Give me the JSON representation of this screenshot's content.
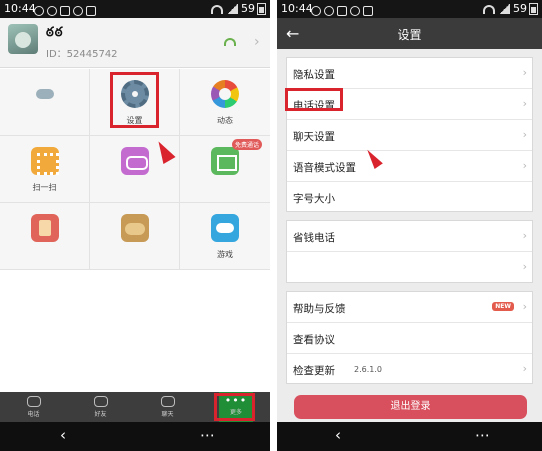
{
  "left": {
    "status": {
      "time": "10:44",
      "battery": "59"
    },
    "profile": {
      "name": "ఠఠ",
      "id": "ID：52445742"
    },
    "grid": [
      {
        "label": "",
        "icon": "cloud-icon"
      },
      {
        "label": "设置",
        "icon": "gear-icon"
      },
      {
        "label": "动态",
        "icon": "colorwheel-icon"
      },
      {
        "label": "扫一扫",
        "icon": "qr-scan-icon"
      },
      {
        "label": "",
        "icon": "purple-app-icon"
      },
      {
        "label": "",
        "icon": "mail-icon",
        "badge": "免费通话"
      },
      {
        "label": "",
        "icon": "gift-icon"
      },
      {
        "label": "",
        "icon": "food-icon"
      },
      {
        "label": "游戏",
        "icon": "gamepad-icon"
      }
    ],
    "tabs": [
      {
        "label": "电话",
        "icon": "dialpad-icon"
      },
      {
        "label": "好友",
        "icon": "friends-icon"
      },
      {
        "label": "聊天",
        "icon": "chat-icon"
      },
      {
        "label": "更多",
        "icon": "more-dots-icon",
        "active": true
      }
    ],
    "nav": {
      "back": "‹",
      "menu": "⋯"
    }
  },
  "right": {
    "status": {
      "time": "10:44",
      "battery": "59"
    },
    "title": "设置",
    "back_icon": "←",
    "group1": [
      "隐私设置",
      "电话设置",
      "聊天设置",
      "语音模式设置",
      "字号大小"
    ],
    "group2": [
      "省钱电话",
      ""
    ],
    "group3": [
      {
        "label": "帮助与反馈",
        "badge": "NEW"
      },
      {
        "label": "查看协议"
      },
      {
        "label": "检查更新",
        "value": "2.6.1.0"
      }
    ],
    "logout": "退出登录",
    "nav": {
      "back": "‹",
      "menu": "⋯"
    }
  },
  "colors": {
    "highlight": "#d9232d",
    "accent": "#1f8e36",
    "logout": "#d8505e"
  }
}
